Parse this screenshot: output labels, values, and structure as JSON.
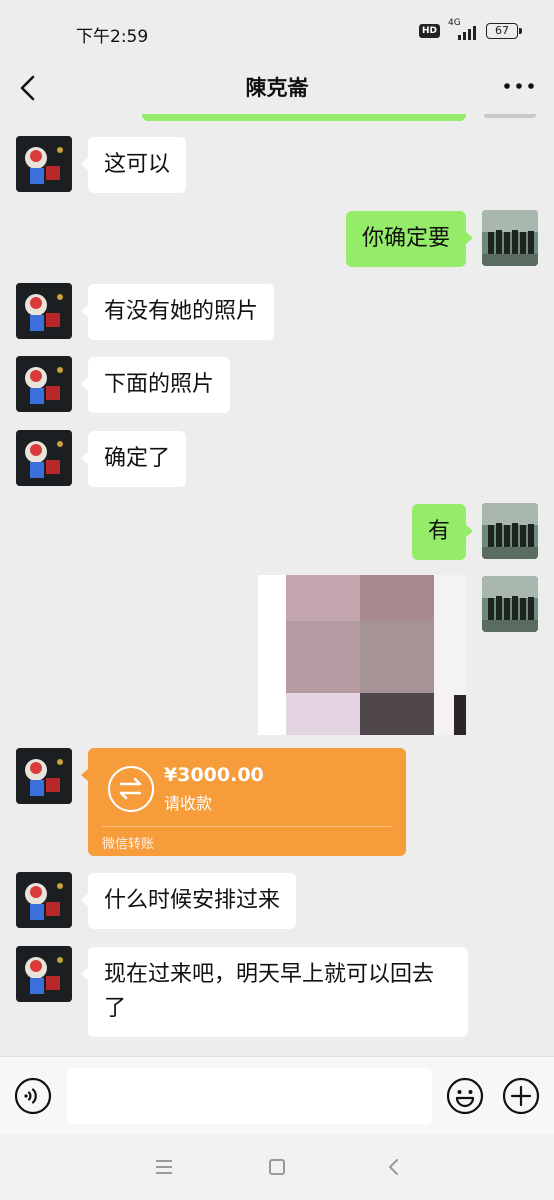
{
  "status_bar": {
    "time": "下午2:59",
    "hd": "HD",
    "network": "4G",
    "battery": "67"
  },
  "nav": {
    "title": "陳克崙",
    "back_icon": "chevron-left-icon",
    "more_icon": "more-dots-icon"
  },
  "messages": [
    {
      "side": "left",
      "type": "text",
      "text": "这可以"
    },
    {
      "side": "right",
      "type": "text",
      "text": "你确定要"
    },
    {
      "side": "left",
      "type": "text",
      "text": "有没有她的照片"
    },
    {
      "side": "left",
      "type": "text",
      "text": "下面的照片"
    },
    {
      "side": "left",
      "type": "text",
      "text": "确定了"
    },
    {
      "side": "right",
      "type": "text",
      "text": "有"
    },
    {
      "side": "right",
      "type": "image",
      "blurred": true
    },
    {
      "side": "left",
      "type": "transfer",
      "amount": "¥3000.00",
      "status": "请收款",
      "footer": "微信转账"
    },
    {
      "side": "left",
      "type": "text",
      "text": "什么时候安排过来"
    },
    {
      "side": "left",
      "type": "text",
      "text": "现在过来吧，明天早上就可以回去了"
    }
  ],
  "input_bar": {
    "placeholder": "",
    "voice_icon": "voice-icon",
    "emoji_icon": "emoji-icon",
    "plus_icon": "plus-icon"
  },
  "system_nav": {
    "menu_icon": "menu-icon",
    "home_icon": "home-icon",
    "back_icon": "back-icon"
  },
  "colors": {
    "background": "#ededed",
    "sent_bubble": "#95ec69",
    "received_bubble": "#ffffff",
    "transfer_card": "#f79c3b"
  }
}
